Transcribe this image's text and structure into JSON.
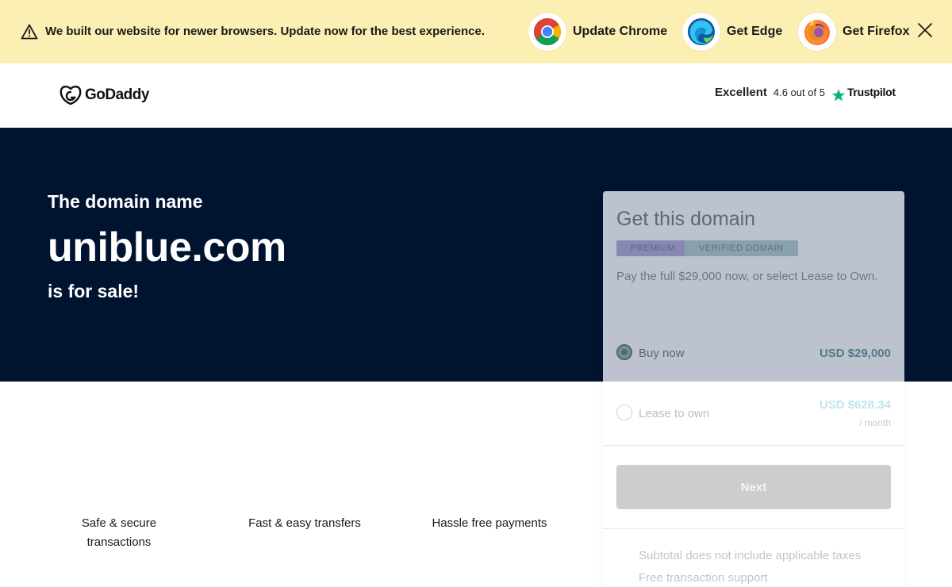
{
  "banner": {
    "message": "We built our website for newer browsers. Update now for the best experience.",
    "browsers": [
      {
        "label": "Update Chrome",
        "icon": "chrome-icon"
      },
      {
        "label": "Get Edge",
        "icon": "edge-icon"
      },
      {
        "label": "Get Firefox",
        "icon": "firefox-icon"
      }
    ],
    "background": "#fbefb3"
  },
  "header": {
    "logo_text": "GoDaddy",
    "rating_word": "Excellent",
    "rating_score": "4.6 out of 5",
    "rating_brand": "Trustpilot",
    "star_color": "#00b67a"
  },
  "hero": {
    "line1": "The domain name",
    "domain": "uniblue.com",
    "line3": "is for sale!",
    "background": "#00132f"
  },
  "features": [
    {
      "label": "Safe & secure transactions"
    },
    {
      "label": "Fast & easy transfers"
    },
    {
      "label": "Hassle free payments"
    }
  ],
  "card": {
    "title": "Get this domain",
    "badges": [
      "PREMIUM",
      "VERIFIED DOMAIN"
    ],
    "description": "Pay the full $29,000 now, or select Lease to Own.",
    "options": [
      {
        "label": "Buy now",
        "price": "USD $29,000",
        "unit": "",
        "selected": true
      },
      {
        "label": "Lease to own",
        "price": "USD $628.34",
        "unit": "/ month",
        "selected": false
      }
    ],
    "next_label": "Next",
    "fine_print": [
      "Subtotal does not include applicable taxes",
      "Free transaction support"
    ]
  }
}
